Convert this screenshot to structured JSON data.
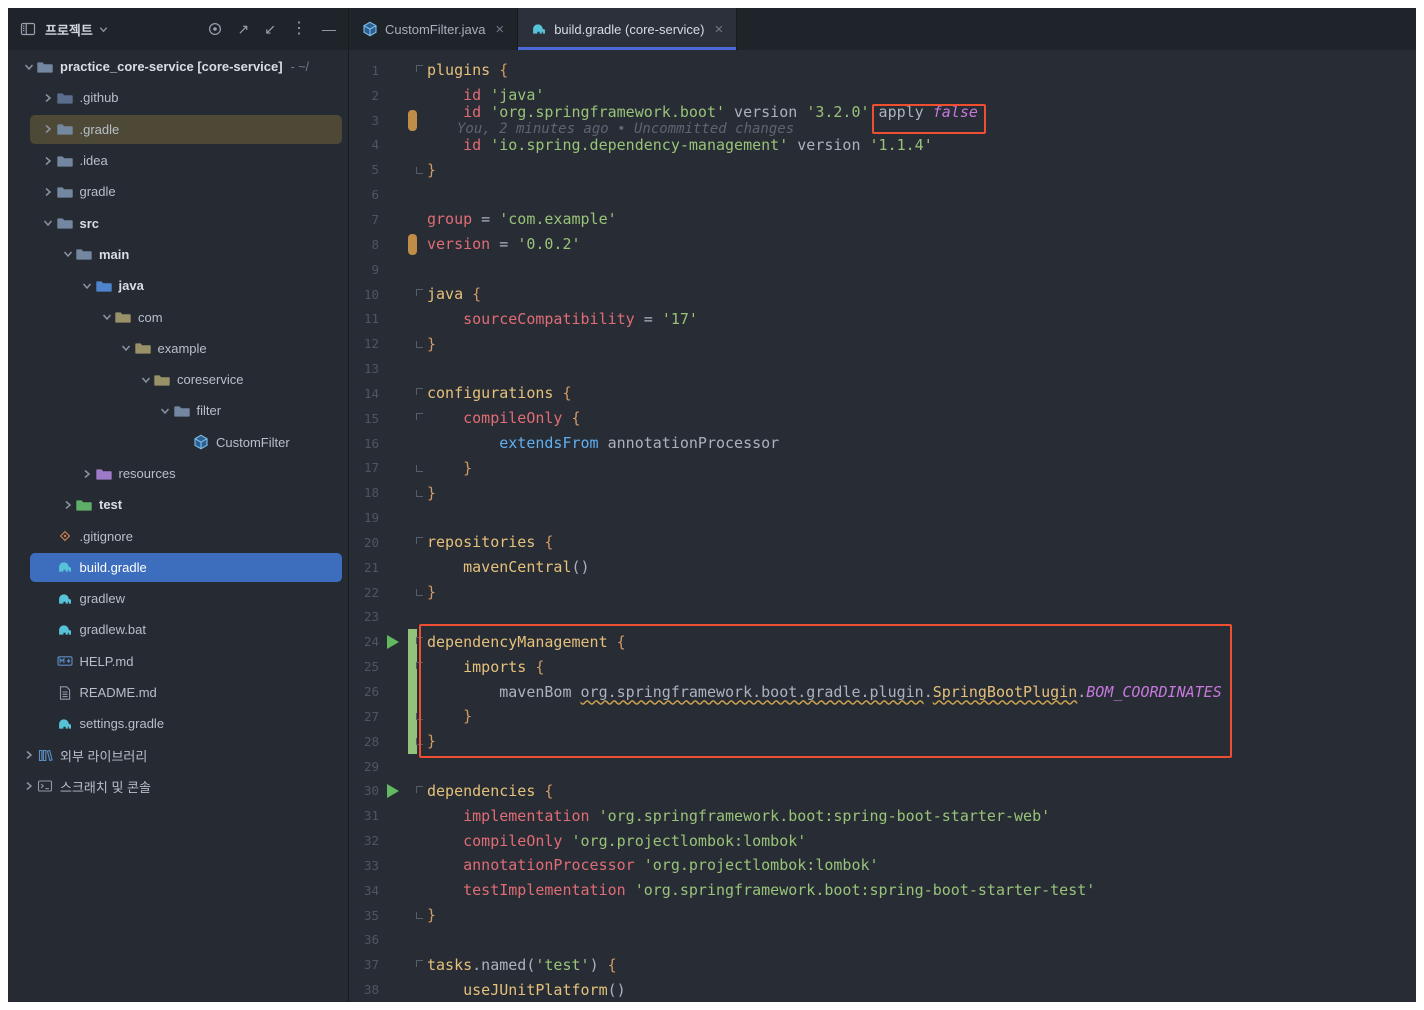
{
  "colors": {
    "annotation_red": "#ef4e30",
    "selection_blue": "#3d6dbd",
    "row_highlight_olive": "#4d4936",
    "tab_underline": "#4d6bd8",
    "added_marker_green": "#93c37b",
    "modified_marker_orange": "#c08d49",
    "run_icon_green": "#63b960",
    "editor_background": "#282c34"
  },
  "sidebar": {
    "header": {
      "title": "프로젝트",
      "action_icons": [
        "tool-window-icon",
        "chevron-down-icon",
        "locate-icon",
        "expand-arrow-icon",
        "collapse-arrow-icon",
        "more-options-icon",
        "hide-panel-icon"
      ],
      "expand_glyph": "↗",
      "collapse_glyph": "↙",
      "more_glyph": "⋮",
      "hide_glyph": "—"
    },
    "tree": [
      {
        "label": "practice_core-service [core-service]",
        "suffix": "- ~/",
        "level": 0,
        "chevron": "expanded",
        "icon": "folder",
        "color": "#7487a0",
        "bold": true
      },
      {
        "label": ".github",
        "level": 1,
        "chevron": "collapsed",
        "icon": "folder",
        "color": "#5b6d8c"
      },
      {
        "label": ".gradle",
        "level": 1,
        "chevron": "collapsed",
        "icon": "folder",
        "color": "#7487a0",
        "highlight": true
      },
      {
        "label": ".idea",
        "level": 1,
        "chevron": "collapsed",
        "icon": "folder",
        "color": "#7487a0"
      },
      {
        "label": "gradle",
        "level": 1,
        "chevron": "collapsed",
        "icon": "folder",
        "color": "#7487a0"
      },
      {
        "label": "src",
        "level": 1,
        "chevron": "expanded",
        "icon": "folder",
        "color": "#7487a0",
        "bold": true
      },
      {
        "label": "main",
        "level": 2,
        "chevron": "expanded",
        "icon": "folder",
        "color": "#7487a0",
        "bold": true
      },
      {
        "label": "java",
        "level": 3,
        "chevron": "expanded",
        "icon": "folder",
        "color": "#4f83cc",
        "bold": true
      },
      {
        "label": "com",
        "level": 4,
        "chevron": "expanded",
        "icon": "folder",
        "color": "#999167"
      },
      {
        "label": "example",
        "level": 5,
        "chevron": "expanded",
        "icon": "folder",
        "color": "#999167"
      },
      {
        "label": "coreservice",
        "level": 6,
        "chevron": "expanded",
        "icon": "folder",
        "color": "#999167"
      },
      {
        "label": "filter",
        "level": 7,
        "chevron": "expanded",
        "icon": "folder",
        "color": "#7487a0"
      },
      {
        "label": "CustomFilter",
        "level": 8,
        "chevron": "none",
        "icon": "class"
      },
      {
        "label": "resources",
        "level": 3,
        "chevron": "collapsed",
        "icon": "folder",
        "color": "#9d7bc8"
      },
      {
        "label": "test",
        "level": 2,
        "chevron": "collapsed",
        "icon": "folder",
        "color": "#5fae68",
        "bold": true
      },
      {
        "label": ".gitignore",
        "level": 1,
        "chevron": "none",
        "icon": "git"
      },
      {
        "label": "build.gradle",
        "level": 1,
        "chevron": "none",
        "icon": "gradle",
        "selected": true
      },
      {
        "label": "gradlew",
        "level": 1,
        "chevron": "none",
        "icon": "gradle"
      },
      {
        "label": "gradlew.bat",
        "level": 1,
        "chevron": "none",
        "icon": "gradle"
      },
      {
        "label": "HELP.md",
        "level": 1,
        "chevron": "none",
        "icon": "markdown"
      },
      {
        "label": "README.md",
        "level": 1,
        "chevron": "none",
        "icon": "doc"
      },
      {
        "label": "settings.gradle",
        "level": 1,
        "chevron": "none",
        "icon": "gradle"
      },
      {
        "label": "외부 라이브러리",
        "level": 0,
        "chevron": "collapsed",
        "icon": "library"
      },
      {
        "label": "스크래치 및 콘솔",
        "level": 0,
        "chevron": "collapsed",
        "icon": "console"
      }
    ]
  },
  "editor": {
    "tabs": [
      {
        "label": "CustomFilter.java",
        "icon": "class",
        "active": false
      },
      {
        "label": "build.gradle (core-service)",
        "icon": "gradle",
        "active": true
      }
    ],
    "annotations": [
      {
        "id": "apply-false-highlight"
      },
      {
        "id": "dependency-management-highlight"
      }
    ],
    "lines": [
      {
        "num": 1,
        "t": [
          [
            "f",
            "plugins"
          ],
          [
            "d",
            " "
          ],
          [
            "b",
            "{"
          ]
        ],
        "fold": "s"
      },
      {
        "num": 2,
        "t": [
          [
            "d",
            "    "
          ],
          [
            "k",
            "id"
          ],
          [
            "d",
            " "
          ],
          [
            "s",
            "'java'"
          ]
        ]
      },
      {
        "num": 3,
        "t": [
          [
            "d",
            "    "
          ],
          [
            "k",
            "id"
          ],
          [
            "d",
            " "
          ],
          [
            "s",
            "'org.springframework.boot'"
          ],
          [
            "d",
            " version "
          ],
          [
            "s",
            "'3.2.0'"
          ],
          [
            "d",
            " apply "
          ],
          [
            "bo",
            "false"
          ]
        ],
        "chg": "o",
        "blame": "You, 2 minutes ago • Uncommitted changes"
      },
      {
        "num": 4,
        "t": [
          [
            "d",
            "    "
          ],
          [
            "k",
            "id"
          ],
          [
            "d",
            " "
          ],
          [
            "s",
            "'io.spring.dependency-management'"
          ],
          [
            "d",
            " version "
          ],
          [
            "s",
            "'1.1.4'"
          ]
        ]
      },
      {
        "num": 5,
        "t": [
          [
            "b",
            "}"
          ]
        ],
        "fold": "e"
      },
      {
        "num": 6,
        "t": []
      },
      {
        "num": 7,
        "t": [
          [
            "k",
            "group"
          ],
          [
            "d",
            " = "
          ],
          [
            "s",
            "'com.example'"
          ]
        ]
      },
      {
        "num": 8,
        "t": [
          [
            "k",
            "version"
          ],
          [
            "d",
            " = "
          ],
          [
            "s",
            "'0.0.2'"
          ]
        ],
        "chg": "o"
      },
      {
        "num": 9,
        "t": []
      },
      {
        "num": 10,
        "t": [
          [
            "f",
            "java"
          ],
          [
            "d",
            " "
          ],
          [
            "b",
            "{"
          ]
        ],
        "fold": "s"
      },
      {
        "num": 11,
        "t": [
          [
            "d",
            "    "
          ],
          [
            "k",
            "sourceCompatibility"
          ],
          [
            "d",
            " = "
          ],
          [
            "s",
            "'17'"
          ]
        ]
      },
      {
        "num": 12,
        "t": [
          [
            "b",
            "}"
          ]
        ],
        "fold": "e"
      },
      {
        "num": 13,
        "t": []
      },
      {
        "num": 14,
        "t": [
          [
            "f",
            "configurations"
          ],
          [
            "d",
            " "
          ],
          [
            "b",
            "{"
          ]
        ],
        "fold": "s"
      },
      {
        "num": 15,
        "t": [
          [
            "d",
            "    "
          ],
          [
            "k",
            "compileOnly"
          ],
          [
            "d",
            " "
          ],
          [
            "b",
            "{"
          ]
        ],
        "fold": "s"
      },
      {
        "num": 16,
        "t": [
          [
            "d",
            "        "
          ],
          [
            "bl",
            "extendsFrom"
          ],
          [
            "d",
            " annotationProcessor"
          ]
        ]
      },
      {
        "num": 17,
        "t": [
          [
            "d",
            "    "
          ],
          [
            "b",
            "}"
          ]
        ],
        "fold": "e"
      },
      {
        "num": 18,
        "t": [
          [
            "b",
            "}"
          ]
        ],
        "fold": "e"
      },
      {
        "num": 19,
        "t": []
      },
      {
        "num": 20,
        "t": [
          [
            "f",
            "repositories"
          ],
          [
            "d",
            " "
          ],
          [
            "b",
            "{"
          ]
        ],
        "fold": "s"
      },
      {
        "num": 21,
        "t": [
          [
            "d",
            "    "
          ],
          [
            "f",
            "mavenCentral"
          ],
          [
            "d",
            "()"
          ]
        ]
      },
      {
        "num": 22,
        "t": [
          [
            "b",
            "}"
          ]
        ],
        "fold": "e"
      },
      {
        "num": 23,
        "t": []
      },
      {
        "num": 24,
        "t": [
          [
            "f",
            "dependencyManagement"
          ],
          [
            "d",
            " "
          ],
          [
            "b",
            "{"
          ]
        ],
        "fold": "s",
        "run": true,
        "chg": "g"
      },
      {
        "num": 25,
        "t": [
          [
            "d",
            "    "
          ],
          [
            "f",
            "imports"
          ],
          [
            "d",
            " "
          ],
          [
            "b",
            "{"
          ]
        ],
        "fold": "s",
        "chg": "g"
      },
      {
        "num": 26,
        "t": [
          [
            "d",
            "        mavenBom "
          ],
          [
            "u",
            "org.springframework.boot.gradle.plugin"
          ],
          [
            "d",
            "."
          ],
          [
            "uf",
            "SpringBootPlugin"
          ],
          [
            "d",
            "."
          ],
          [
            "c",
            "BOM_COORDINATES"
          ]
        ],
        "chg": "g"
      },
      {
        "num": 27,
        "t": [
          [
            "d",
            "    "
          ],
          [
            "b",
            "}"
          ]
        ],
        "fold": "e",
        "chg": "g"
      },
      {
        "num": 28,
        "t": [
          [
            "b",
            "}"
          ]
        ],
        "fold": "e",
        "chg": "g"
      },
      {
        "num": 29,
        "t": []
      },
      {
        "num": 30,
        "t": [
          [
            "f",
            "dependencies"
          ],
          [
            "d",
            " "
          ],
          [
            "b",
            "{"
          ]
        ],
        "fold": "s",
        "run": true
      },
      {
        "num": 31,
        "t": [
          [
            "d",
            "    "
          ],
          [
            "k",
            "implementation"
          ],
          [
            "d",
            " "
          ],
          [
            "s",
            "'org.springframework.boot:spring-boot-starter-web'"
          ]
        ]
      },
      {
        "num": 32,
        "t": [
          [
            "d",
            "    "
          ],
          [
            "k",
            "compileOnly"
          ],
          [
            "d",
            " "
          ],
          [
            "s",
            "'org.projectlombok:lombok'"
          ]
        ]
      },
      {
        "num": 33,
        "t": [
          [
            "d",
            "    "
          ],
          [
            "k",
            "annotationProcessor"
          ],
          [
            "d",
            " "
          ],
          [
            "s",
            "'org.projectlombok:lombok'"
          ]
        ]
      },
      {
        "num": 34,
        "t": [
          [
            "d",
            "    "
          ],
          [
            "k",
            "testImplementation"
          ],
          [
            "d",
            " "
          ],
          [
            "s",
            "'org.springframework.boot:spring-boot-starter-test'"
          ]
        ]
      },
      {
        "num": 35,
        "t": [
          [
            "b",
            "}"
          ]
        ],
        "fold": "e"
      },
      {
        "num": 36,
        "t": []
      },
      {
        "num": 37,
        "t": [
          [
            "f",
            "tasks"
          ],
          [
            "d",
            ".named("
          ],
          [
            "s",
            "'test'"
          ],
          [
            "d",
            ") "
          ],
          [
            "b",
            "{"
          ]
        ],
        "fold": "s"
      },
      {
        "num": 38,
        "t": [
          [
            "d",
            "    "
          ],
          [
            "f",
            "useJUnitPlatform"
          ],
          [
            "d",
            "()"
          ]
        ]
      }
    ]
  }
}
